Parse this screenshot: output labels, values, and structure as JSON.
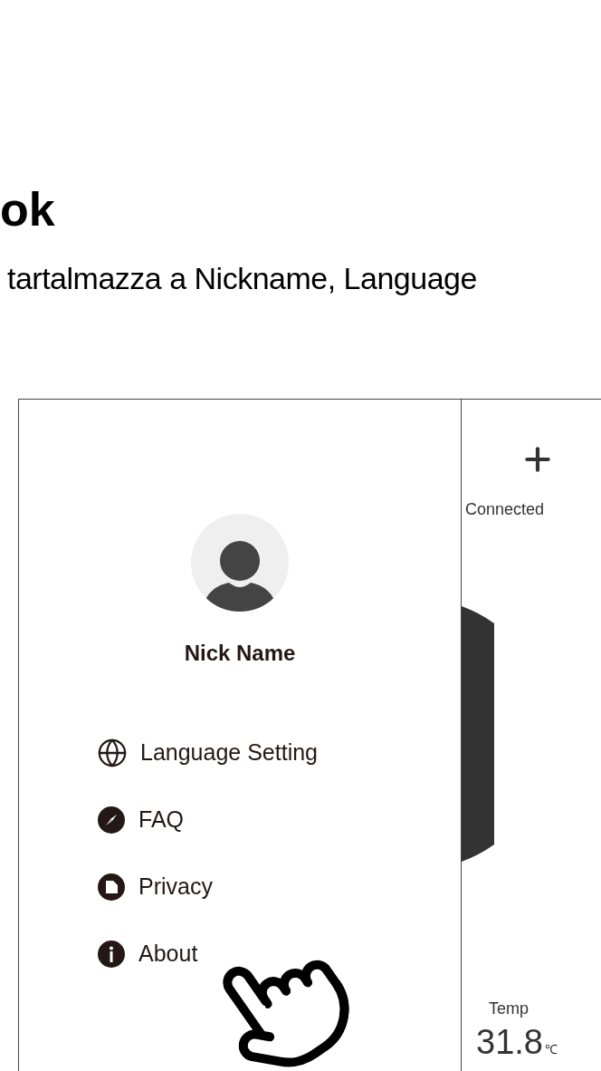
{
  "heading": "ok",
  "sentence": "tartalmazza a Nickname, Language",
  "drawer": {
    "nickname": "Nick Name",
    "menu": [
      {
        "label": "Language Setting",
        "kind": "globe"
      },
      {
        "label": "FAQ",
        "kind": "compass"
      },
      {
        "label": "Privacy",
        "kind": "document"
      },
      {
        "label": "About",
        "kind": "info"
      }
    ]
  },
  "main": {
    "status": "Connected",
    "temp_label": "Temp",
    "temp_value": "31.8",
    "temp_unit": "℃"
  }
}
